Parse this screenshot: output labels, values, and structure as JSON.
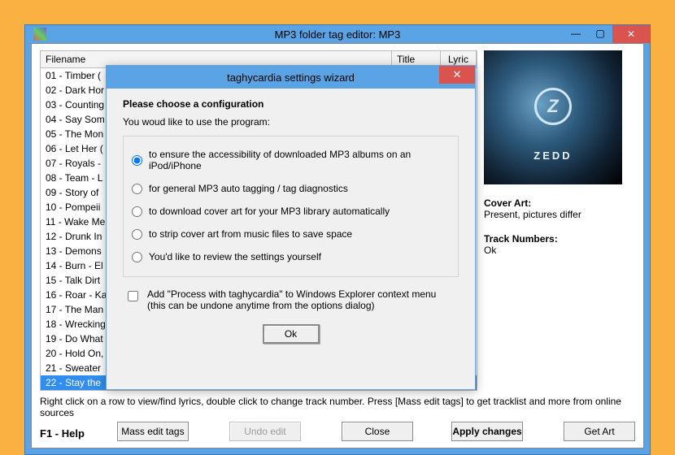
{
  "window": {
    "title": "MP3 folder tag editor: MP3"
  },
  "table": {
    "headers": {
      "filename": "Filename",
      "title": "Title",
      "lyric": "Lyric"
    },
    "rows": [
      {
        "fn": "01 - Timber (",
        "lyr": "-"
      },
      {
        "fn": "02 - Dark Hor",
        "lyr": "-"
      },
      {
        "fn": "03 - Counting",
        "lyr": "-"
      },
      {
        "fn": "04 - Say Som",
        "lyr": "-"
      },
      {
        "fn": "05 - The Mon",
        "lyr": "-"
      },
      {
        "fn": "06 - Let Her (",
        "lyr": "-"
      },
      {
        "fn": "07 - Royals -",
        "lyr": "-"
      },
      {
        "fn": "08 - Team - L",
        "lyr": "-"
      },
      {
        "fn": "09 - Story of",
        "lyr": "-"
      },
      {
        "fn": "10 - Pompeii",
        "lyr": "-"
      },
      {
        "fn": "11 - Wake Me",
        "lyr": "-"
      },
      {
        "fn": "12 - Drunk In",
        "lyr": "-"
      },
      {
        "fn": "13 - Demons",
        "lyr": "-"
      },
      {
        "fn": "14 - Burn - El",
        "lyr": "-"
      },
      {
        "fn": "15 - Talk Dirt",
        "lyr": "-"
      },
      {
        "fn": "16 - Roar - Ka",
        "lyr": "-"
      },
      {
        "fn": "17 - The Man",
        "lyr": "-"
      },
      {
        "fn": "18 - Wrecking",
        "lyr": "-"
      },
      {
        "fn": "19 - Do What",
        "lyr": "-"
      },
      {
        "fn": "20 - Hold On,",
        "lyr": "-"
      },
      {
        "fn": "21 - Sweater",
        "lyr": "-"
      },
      {
        "fn": "22 - Stay the",
        "lyr": "-",
        "selected": true
      }
    ]
  },
  "side": {
    "cover_label": "Cover Art:",
    "cover_val": "Present, pictures differ",
    "track_label": "Track Numbers:",
    "track_val": "Ok",
    "brand": "ZEDD"
  },
  "footer": {
    "hint": "Right click on a row to view/find lyrics, double click to change track number. Press [Mass edit tags] to get tracklist and more from online sources",
    "help": "F1 - Help",
    "buttons": {
      "mass": "Mass edit tags",
      "undo": "Undo edit",
      "close": "Close",
      "apply": "Apply changes",
      "getart": "Get Art"
    }
  },
  "wizard": {
    "title": "taghycardia settings wizard",
    "heading": "Please choose a configuration",
    "subtitle": "You woud like to use the program:",
    "options": {
      "opt1": "to ensure the accessibility of downloaded MP3 albums on an iPod/iPhone",
      "opt2": "for general MP3 auto tagging / tag diagnostics",
      "opt3": "to download cover art for your MP3 library automatically",
      "opt4": "to strip cover art from music files to save space",
      "opt5": "You'd like to review the settings yourself"
    },
    "checkbox": "Add \"Process with taghycardia\" to Windows Explorer context menu (this can be undone anytime from the options dialog)",
    "ok": "Ok"
  }
}
